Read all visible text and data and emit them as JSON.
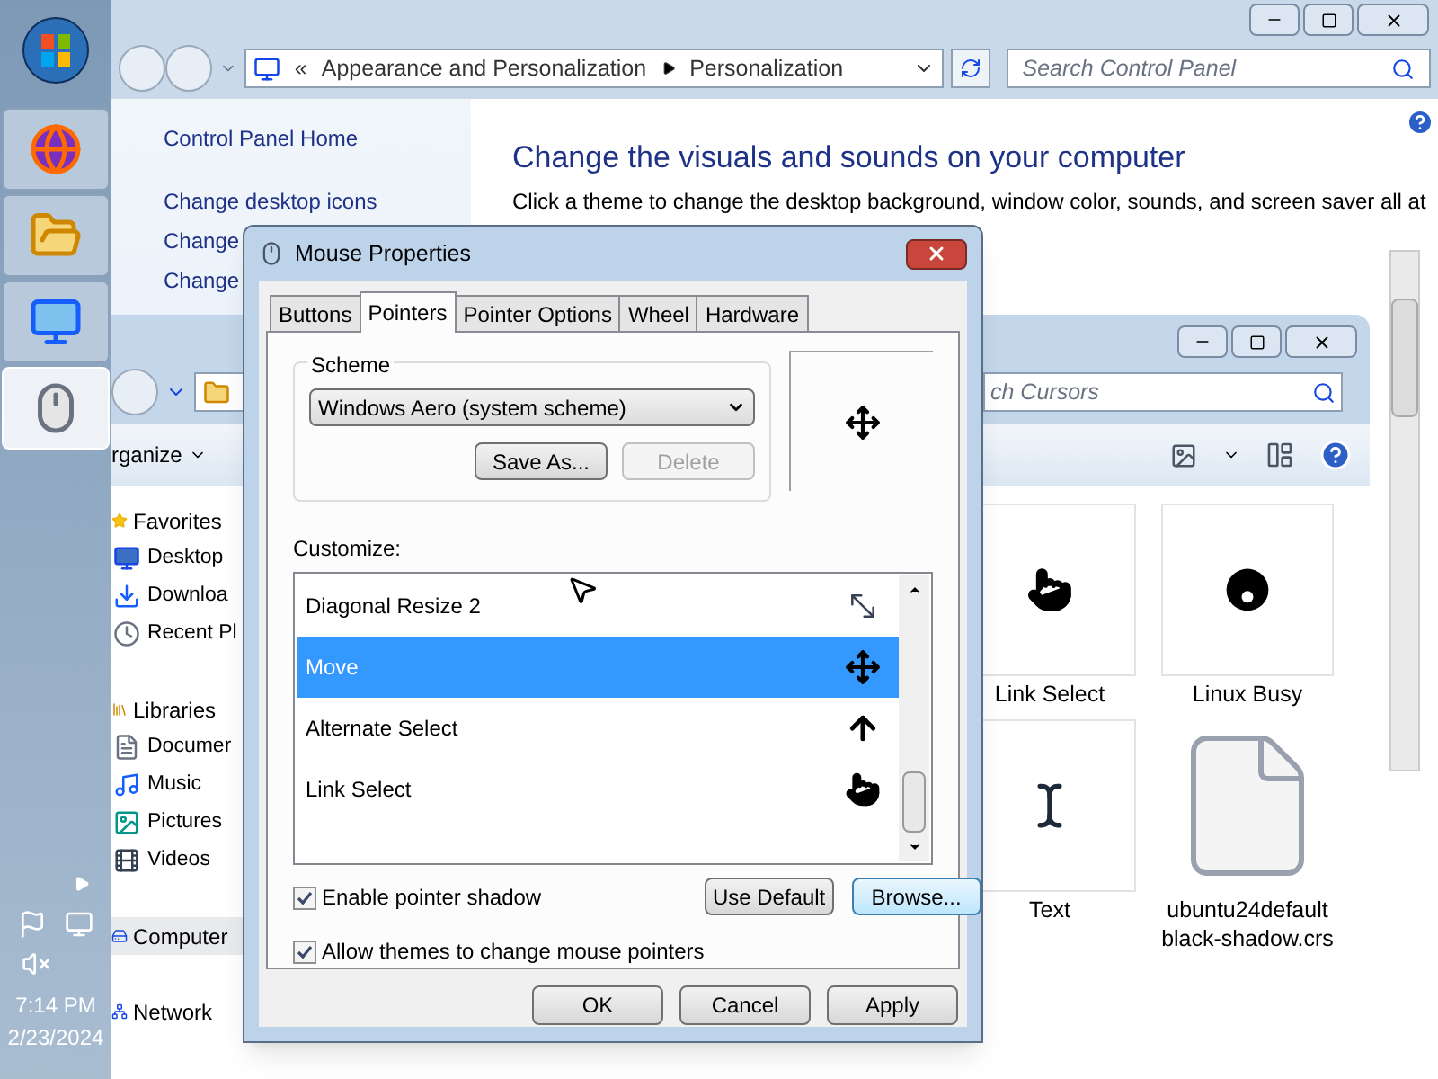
{
  "taskbar": {
    "buttons": [
      {
        "kind": "browser",
        "selected": false
      },
      {
        "kind": "explorer",
        "selected": false
      },
      {
        "kind": "control-panel",
        "selected": false
      },
      {
        "kind": "mouse",
        "selected": true
      }
    ],
    "time": "7:14 PM",
    "date": "2/23/2024"
  },
  "control_panel": {
    "breadcrumb_prefix": "«",
    "breadcrumbs": [
      "Appearance and Personalization",
      "Personalization"
    ],
    "search": {
      "placeholder": "Search Control Panel"
    },
    "links": [
      "Control Panel Home",
      "Change desktop icons",
      "Change",
      "Change"
    ],
    "heading": "Change the visuals and sounds on your computer",
    "description": "Click a theme to change the desktop background, window color, sounds, and screen saver all at"
  },
  "explorer": {
    "search": {
      "placeholder": "ch Cursors"
    },
    "organize": "rganize",
    "nav": [
      {
        "label": "Favorites",
        "kind": "favorites",
        "selected": false,
        "children": [
          {
            "label": "Desktop",
            "kind": "desktop",
            "selected": false
          },
          {
            "label": "Downloa",
            "kind": "downloads",
            "selected": false
          },
          {
            "label": "Recent Pl",
            "kind": "recent",
            "selected": false
          }
        ]
      },
      {
        "label": "Libraries",
        "kind": "libraries",
        "selected": false,
        "children": [
          {
            "label": "Documer",
            "kind": "documents",
            "selected": false
          },
          {
            "label": "Music",
            "kind": "music",
            "selected": false
          },
          {
            "label": "Pictures",
            "kind": "pictures",
            "selected": false
          },
          {
            "label": "Videos",
            "kind": "videos",
            "selected": false
          }
        ]
      },
      {
        "label": "Computer",
        "kind": "computer",
        "selected": true
      },
      {
        "label": "Network",
        "kind": "network",
        "selected": false
      }
    ],
    "files": [
      {
        "name": "Link Select",
        "kind": "hand"
      },
      {
        "name": "Linux Busy",
        "kind": "busy"
      },
      {
        "name": "Text",
        "kind": "text"
      },
      {
        "name": "ubuntu24default black-shadow.crs",
        "kind": "file"
      }
    ]
  },
  "dialog": {
    "title": "Mouse Properties",
    "tabs": [
      {
        "label": "Buttons",
        "selected": false
      },
      {
        "label": "Pointers",
        "selected": true
      },
      {
        "label": "Pointer Options",
        "selected": false
      },
      {
        "label": "Wheel",
        "selected": false
      },
      {
        "label": "Hardware",
        "selected": false
      }
    ],
    "scheme": {
      "label": "Scheme",
      "value": "Windows Aero (system scheme)",
      "buttons": [
        {
          "label": "Save As...",
          "disabled": false
        },
        {
          "label": "Delete",
          "disabled": true
        }
      ]
    },
    "preview": {
      "kind": "move"
    },
    "customize_label": "Customize:",
    "pointers": [
      {
        "name": "Diagonal Resize 2",
        "kind": "diagonal",
        "selected": false
      },
      {
        "name": "Move",
        "kind": "move",
        "selected": true
      },
      {
        "name": "Alternate Select",
        "kind": "up-arrow",
        "selected": false
      },
      {
        "name": "Link Select",
        "kind": "hand",
        "selected": false
      }
    ],
    "checkboxes": [
      {
        "label": "Enable pointer shadow",
        "checked": true
      },
      {
        "label": "Allow themes to change mouse pointers",
        "checked": true
      }
    ],
    "list_buttons": [
      {
        "label": "Use Default",
        "focused": false
      },
      {
        "label": "Browse...",
        "focused": true
      }
    ],
    "footer_buttons": [
      "OK",
      "Cancel",
      "Apply"
    ]
  }
}
